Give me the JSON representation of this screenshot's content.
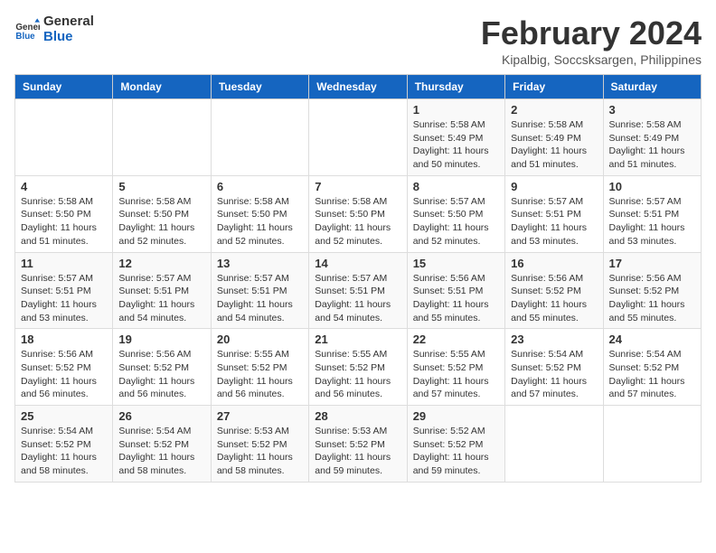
{
  "logo": {
    "line1": "General",
    "line2": "Blue"
  },
  "title": "February 2024",
  "subtitle": "Kipalbig, Soccsksargen, Philippines",
  "days_of_week": [
    "Sunday",
    "Monday",
    "Tuesday",
    "Wednesday",
    "Thursday",
    "Friday",
    "Saturday"
  ],
  "weeks": [
    [
      {
        "day": "",
        "info": ""
      },
      {
        "day": "",
        "info": ""
      },
      {
        "day": "",
        "info": ""
      },
      {
        "day": "",
        "info": ""
      },
      {
        "day": "1",
        "info": "Sunrise: 5:58 AM\nSunset: 5:49 PM\nDaylight: 11 hours and 50 minutes."
      },
      {
        "day": "2",
        "info": "Sunrise: 5:58 AM\nSunset: 5:49 PM\nDaylight: 11 hours and 51 minutes."
      },
      {
        "day": "3",
        "info": "Sunrise: 5:58 AM\nSunset: 5:49 PM\nDaylight: 11 hours and 51 minutes."
      }
    ],
    [
      {
        "day": "4",
        "info": "Sunrise: 5:58 AM\nSunset: 5:50 PM\nDaylight: 11 hours and 51 minutes."
      },
      {
        "day": "5",
        "info": "Sunrise: 5:58 AM\nSunset: 5:50 PM\nDaylight: 11 hours and 52 minutes."
      },
      {
        "day": "6",
        "info": "Sunrise: 5:58 AM\nSunset: 5:50 PM\nDaylight: 11 hours and 52 minutes."
      },
      {
        "day": "7",
        "info": "Sunrise: 5:58 AM\nSunset: 5:50 PM\nDaylight: 11 hours and 52 minutes."
      },
      {
        "day": "8",
        "info": "Sunrise: 5:57 AM\nSunset: 5:50 PM\nDaylight: 11 hours and 52 minutes."
      },
      {
        "day": "9",
        "info": "Sunrise: 5:57 AM\nSunset: 5:51 PM\nDaylight: 11 hours and 53 minutes."
      },
      {
        "day": "10",
        "info": "Sunrise: 5:57 AM\nSunset: 5:51 PM\nDaylight: 11 hours and 53 minutes."
      }
    ],
    [
      {
        "day": "11",
        "info": "Sunrise: 5:57 AM\nSunset: 5:51 PM\nDaylight: 11 hours and 53 minutes."
      },
      {
        "day": "12",
        "info": "Sunrise: 5:57 AM\nSunset: 5:51 PM\nDaylight: 11 hours and 54 minutes."
      },
      {
        "day": "13",
        "info": "Sunrise: 5:57 AM\nSunset: 5:51 PM\nDaylight: 11 hours and 54 minutes."
      },
      {
        "day": "14",
        "info": "Sunrise: 5:57 AM\nSunset: 5:51 PM\nDaylight: 11 hours and 54 minutes."
      },
      {
        "day": "15",
        "info": "Sunrise: 5:56 AM\nSunset: 5:51 PM\nDaylight: 11 hours and 55 minutes."
      },
      {
        "day": "16",
        "info": "Sunrise: 5:56 AM\nSunset: 5:52 PM\nDaylight: 11 hours and 55 minutes."
      },
      {
        "day": "17",
        "info": "Sunrise: 5:56 AM\nSunset: 5:52 PM\nDaylight: 11 hours and 55 minutes."
      }
    ],
    [
      {
        "day": "18",
        "info": "Sunrise: 5:56 AM\nSunset: 5:52 PM\nDaylight: 11 hours and 56 minutes."
      },
      {
        "day": "19",
        "info": "Sunrise: 5:56 AM\nSunset: 5:52 PM\nDaylight: 11 hours and 56 minutes."
      },
      {
        "day": "20",
        "info": "Sunrise: 5:55 AM\nSunset: 5:52 PM\nDaylight: 11 hours and 56 minutes."
      },
      {
        "day": "21",
        "info": "Sunrise: 5:55 AM\nSunset: 5:52 PM\nDaylight: 11 hours and 56 minutes."
      },
      {
        "day": "22",
        "info": "Sunrise: 5:55 AM\nSunset: 5:52 PM\nDaylight: 11 hours and 57 minutes."
      },
      {
        "day": "23",
        "info": "Sunrise: 5:54 AM\nSunset: 5:52 PM\nDaylight: 11 hours and 57 minutes."
      },
      {
        "day": "24",
        "info": "Sunrise: 5:54 AM\nSunset: 5:52 PM\nDaylight: 11 hours and 57 minutes."
      }
    ],
    [
      {
        "day": "25",
        "info": "Sunrise: 5:54 AM\nSunset: 5:52 PM\nDaylight: 11 hours and 58 minutes."
      },
      {
        "day": "26",
        "info": "Sunrise: 5:54 AM\nSunset: 5:52 PM\nDaylight: 11 hours and 58 minutes."
      },
      {
        "day": "27",
        "info": "Sunrise: 5:53 AM\nSunset: 5:52 PM\nDaylight: 11 hours and 58 minutes."
      },
      {
        "day": "28",
        "info": "Sunrise: 5:53 AM\nSunset: 5:52 PM\nDaylight: 11 hours and 59 minutes."
      },
      {
        "day": "29",
        "info": "Sunrise: 5:52 AM\nSunset: 5:52 PM\nDaylight: 11 hours and 59 minutes."
      },
      {
        "day": "",
        "info": ""
      },
      {
        "day": "",
        "info": ""
      }
    ]
  ]
}
